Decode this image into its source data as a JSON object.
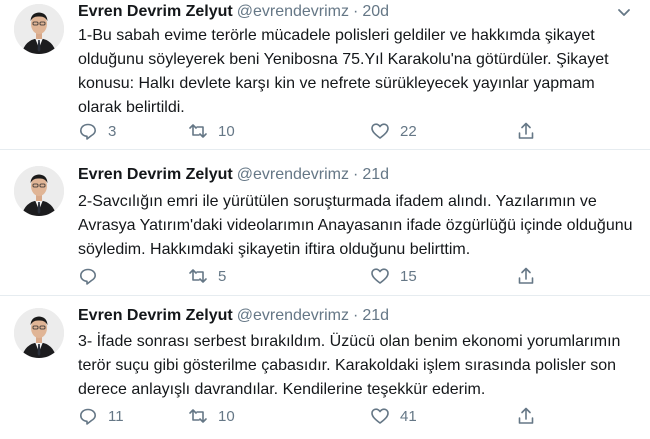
{
  "tweets": [
    {
      "name": "Evren Devrim Zelyut",
      "handle": "@evrendevrimz",
      "separator": "·",
      "time": "20d",
      "text": "1-Bu sabah evime terörle mücadele polisleri geldiler ve hakkımda şikayet olduğunu söyleyerek beni Yenibosna 75.Yıl Karakolu'na götürdüler. Şikayet konusu: Halkı devlete karşı kin ve nefrete sürükleyecek yayınlar yapmam olarak belirtildi.",
      "replies": "3",
      "retweets": "10",
      "likes": "22"
    },
    {
      "name": "Evren Devrim Zelyut",
      "handle": "@evrendevrimz",
      "separator": "·",
      "time": "21d",
      "text": "2-Savcılığın emri ile yürütülen soruşturmada ifadem alındı. Yazılarımın ve Avrasya Yatırım'daki videolarımın Anayasanın ifade özgürlüğü içinde olduğunu söyledim. Hakkımdaki şikayetin iftira olduğunu belirttim.",
      "replies": "",
      "retweets": "5",
      "likes": "15"
    },
    {
      "name": "Evren Devrim Zelyut",
      "handle": "@evrendevrimz",
      "separator": "·",
      "time": "21d",
      "text": "3- İfade sonrası serbest bırakıldım. Üzücü olan benim ekonomi yorumlarımın terör suçu gibi gösterilme çabasıdır. Karakoldaki işlem sırasında polisler son derece anlayışlı davrandılar. Kendilerine teşekkür ederim.",
      "replies": "11",
      "retweets": "10",
      "likes": "41"
    }
  ],
  "icons": {
    "reply": "reply-icon",
    "retweet": "retweet-icon",
    "like": "like-icon",
    "share": "share-icon",
    "more": "chevron-down-icon"
  },
  "colors": {
    "secondary_text": "#657786",
    "divider": "#e6ecf0",
    "primary_text": "#14171a"
  }
}
